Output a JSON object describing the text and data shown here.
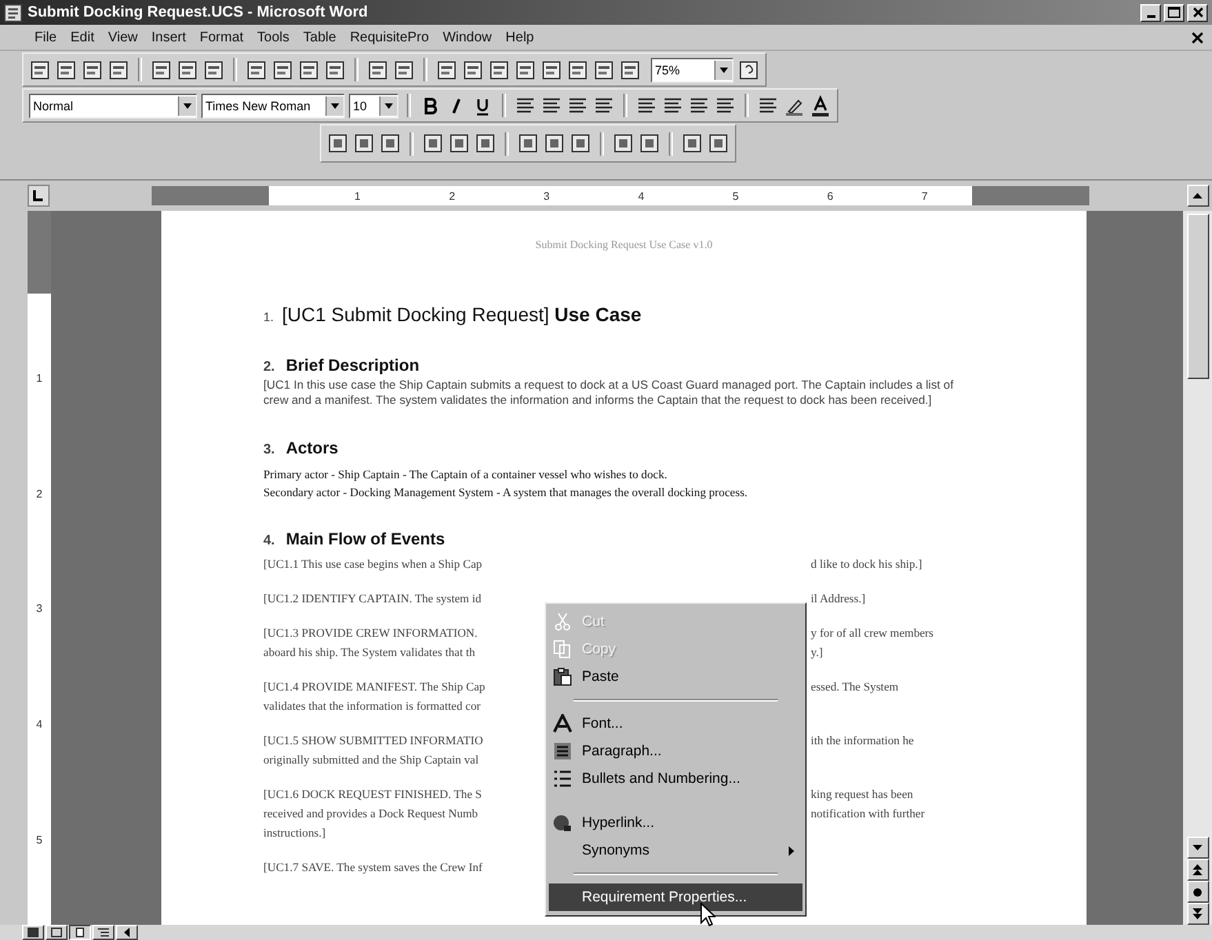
{
  "window": {
    "title": "Submit Docking Request.UCS - Microsoft Word"
  },
  "menu_bar": [
    "File",
    "Edit",
    "View",
    "Insert",
    "Format",
    "Tools",
    "Table",
    "RequisitePro",
    "Window",
    "Help"
  ],
  "formatting": {
    "style": "Normal",
    "font": "Times New Roman",
    "size": "10"
  },
  "zoom": "75%",
  "ruler": {
    "horizontal": [
      "1",
      "2",
      "3",
      "4",
      "5",
      "6",
      "7"
    ],
    "vertical": [
      "1",
      "2",
      "3",
      "4",
      "5"
    ]
  },
  "document": {
    "header": "Submit Docking Request Use Case v1.0",
    "blocks": [
      {
        "kind": "title",
        "number": "1.",
        "text": "[UC1 Submit Docking Request] **Use Case**"
      },
      {
        "kind": "heading",
        "number": "2.",
        "text": "Brief Description"
      },
      {
        "kind": "paragraph",
        "text": "[UC1 In this use case the Ship Captain submits a request to dock at a US Coast Guard managed port.  The Captain includes a list of crew and a manifest.  The system validates the information and informs the Captain that the request to dock has been received.]"
      },
      {
        "kind": "heading",
        "number": "3.",
        "text": "Actors"
      },
      {
        "kind": "lines",
        "lines": [
          "Primary actor - Ship Captain - The Captain of a container vessel who wishes to dock.",
          "Secondary actor - Docking Management System - A system that manages the overall docking process."
        ]
      },
      {
        "kind": "heading",
        "number": "4.",
        "text": "Main Flow of Events"
      },
      {
        "kind": "step",
        "lines": [
          {
            "left": "[UC1.1 This use case begins when a Ship Cap",
            "right": "d like to dock his ship.]"
          }
        ]
      },
      {
        "kind": "step",
        "lines": [
          {
            "left": "[UC1.2 IDENTIFY CAPTAIN. The system id",
            "right": "il Address.]"
          }
        ]
      },
      {
        "kind": "step",
        "lines": [
          {
            "left": "[UC1.3 PROVIDE CREW INFORMATION.",
            "right": "y for of all crew members"
          },
          {
            "left": "aboard his ship.  The System validates that th",
            "right": "y.]"
          }
        ]
      },
      {
        "kind": "step",
        "lines": [
          {
            "left": "[UC1.4 PROVIDE MANIFEST. The Ship Cap",
            "right": "essed.  The System"
          },
          {
            "left": "validates that the information is formatted cor"
          }
        ]
      },
      {
        "kind": "step",
        "lines": [
          {
            "left": "[UC1.5 SHOW SUBMITTED INFORMATIO",
            "right": "ith the information he"
          },
          {
            "left": "originally submitted and the Ship Captain val"
          }
        ]
      },
      {
        "kind": "step",
        "lines": [
          {
            "left": "[UC1.6 DOCK REQUEST FINISHED. The S",
            "right": "king request has been"
          },
          {
            "left": "received and provides a Dock Request Numb",
            "right": "notification with further"
          },
          {
            "left": "instructions.]"
          }
        ]
      },
      {
        "kind": "step",
        "lines": [
          {
            "left": "[UC1.7 SAVE. The system saves the Crew Inf"
          }
        ]
      }
    ]
  },
  "context_menu": [
    {
      "kind": "item",
      "label": "Cut",
      "disabled": true,
      "selected": false
    },
    {
      "kind": "item",
      "label": "Copy",
      "disabled": true,
      "selected": false
    },
    {
      "kind": "item",
      "label": "Paste",
      "disabled": false,
      "selected": false
    },
    {
      "kind": "separator"
    },
    {
      "kind": "item",
      "label": "Font...",
      "disabled": false,
      "selected": false
    },
    {
      "kind": "item",
      "label": "Paragraph...",
      "disabled": false,
      "selected": false
    },
    {
      "kind": "item",
      "label": "Bullets and Numbering...",
      "disabled": false,
      "selected": false
    },
    {
      "kind": "gap"
    },
    {
      "kind": "item",
      "label": "Hyperlink...",
      "disabled": false,
      "selected": false
    },
    {
      "kind": "submenu",
      "label": "Synonyms",
      "disabled": false,
      "selected": false
    },
    {
      "kind": "separator"
    },
    {
      "kind": "item",
      "label": "Requirement Properties...",
      "disabled": false,
      "selected": true
    }
  ]
}
